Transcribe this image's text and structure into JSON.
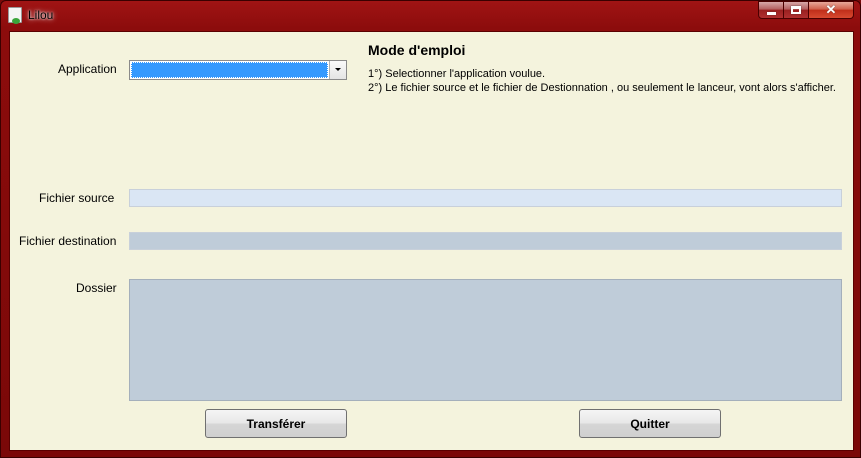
{
  "window": {
    "title": "Lilou"
  },
  "controls": {
    "minimize": "minimize-icon",
    "maximize": "maximize-icon",
    "close": "close-icon"
  },
  "form": {
    "application_label": "Application",
    "application_value": "",
    "source_label": "Fichier source",
    "source_value": "",
    "destination_label": "Fichier destination",
    "destination_value": "",
    "folder_label": "Dossier",
    "folder_value": ""
  },
  "instructions": {
    "title": "Mode d'emploi",
    "steps": [
      "1°) Selectionner l'application voulue.",
      "2°) Le fichier source et le fichier de Destionnation , ou seulement le lanceur, vont alors s'afficher."
    ]
  },
  "buttons": {
    "transfer": "Transférer",
    "quit": "Quitter"
  },
  "colors": {
    "titlebar": "#8c0c0c",
    "client": "#f4f3dd",
    "selection": "#3399ff",
    "field": "#bfccd9"
  }
}
